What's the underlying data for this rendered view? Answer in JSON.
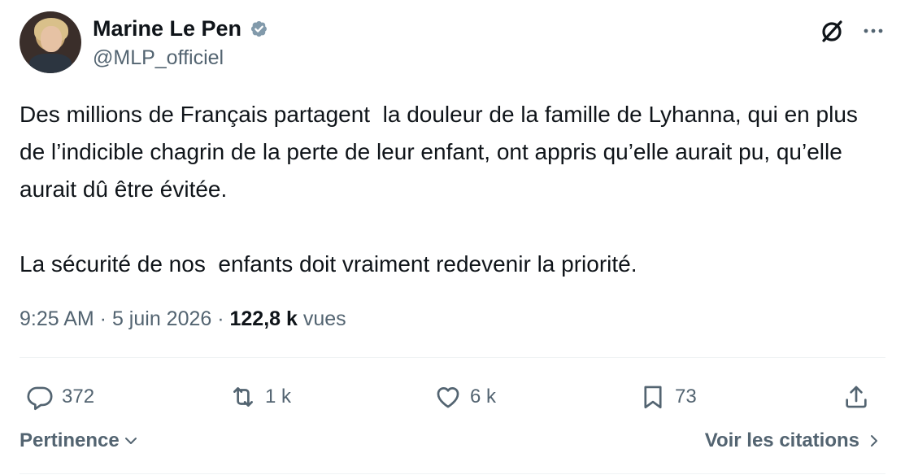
{
  "author": {
    "display_name": "Marine Le Pen",
    "handle": "@MLP_officiel",
    "verified": true
  },
  "tweet": {
    "text": "Des millions de Français partagent  la douleur de la famille de Lyhanna, qui en plus de l’indicible chagrin de la perte de leur enfant, ont appris qu’elle aurait pu, qu’elle aurait dû être évitée.\n\nLa sécurité de nos  enfants doit vraiment redevenir la priorité."
  },
  "meta": {
    "time": "9:25 AM",
    "separator": " · ",
    "date": "5 juin 2026",
    "views_count": "122,8 k",
    "views_label": "vues"
  },
  "actions": {
    "replies": "372",
    "reposts": "1 k",
    "likes": "6 k",
    "bookmarks": "73"
  },
  "footer": {
    "sort_label": "Pertinence",
    "quotes_label": "Voir les citations"
  },
  "colors": {
    "text_primary": "#0f1419",
    "text_secondary": "#536471",
    "verified": "#829aab",
    "divider": "#eff3f4"
  },
  "icons": [
    "verified-badge-icon",
    "grok-icon",
    "more-icon",
    "reply-icon",
    "repost-icon",
    "like-icon",
    "bookmark-icon",
    "share-icon",
    "chevron-down-icon",
    "chevron-right-icon"
  ]
}
